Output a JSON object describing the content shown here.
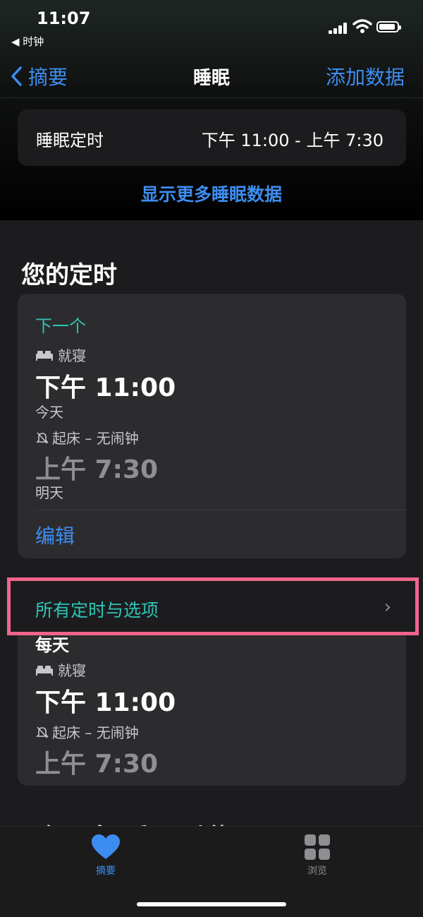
{
  "status": {
    "time": "11:07",
    "back_app": "◀ 时钟"
  },
  "nav": {
    "back_label": "摘要",
    "title": "睡眠",
    "action": "添加数据"
  },
  "sleep_schedule": {
    "label": "睡眠定时",
    "value": "下午 11:00 - 上午 7:30"
  },
  "more_link": "显示更多睡眠数据",
  "section_title": "您的定时",
  "next": {
    "header": "下一个",
    "bedtime_label": "就寝",
    "bedtime": "下午 11:00",
    "bedtime_day": "今天",
    "wake_label": "起床 – 无闹钟",
    "wake": "上午 7:30",
    "wake_day": "明天",
    "edit": "编辑"
  },
  "all_row": {
    "label": "所有定时与选项"
  },
  "everyday": {
    "header": "每天",
    "bedtime_label": "就寝",
    "bedtime": "下午 11:00",
    "wake_label": "起床 – 无闹钟",
    "wake": "上午 7:30"
  },
  "peek_text": "了解更多“睡眠”功能",
  "tabs": [
    {
      "label": "摘要",
      "icon": "heart-icon"
    },
    {
      "label": "浏览",
      "icon": "grid-icon"
    }
  ],
  "colors": {
    "accent": "#3d8df0",
    "teal": "#2ec4b6",
    "highlight": "#f0658d"
  }
}
